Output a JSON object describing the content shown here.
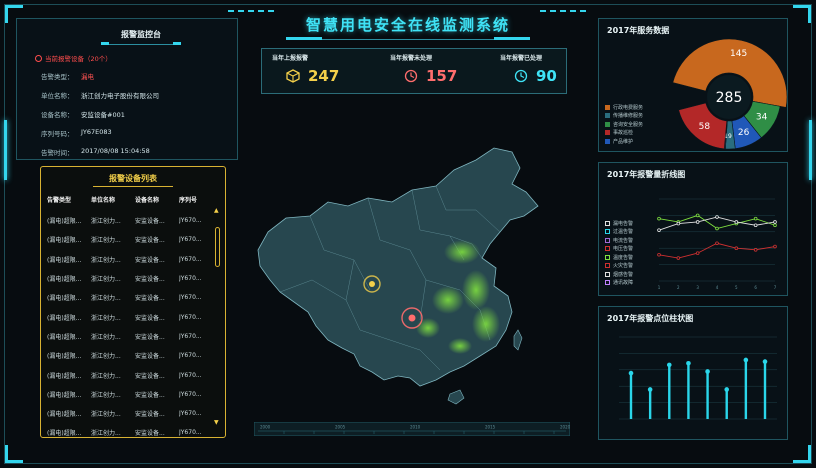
{
  "title": "智慧用电安全在线监测系统",
  "left_panel": {
    "title": "报警监控台",
    "alarm_devices": "当前报警设备（20个）",
    "info": [
      {
        "k": "告警类型：",
        "v": "漏电",
        "red": true
      },
      {
        "k": "单位名称：",
        "v": "浙江创力电子股份有限公司"
      },
      {
        "k": "设备名称：",
        "v": "安监设备#001"
      },
      {
        "k": "序列号码：",
        "v": "JY67E083"
      },
      {
        "k": "告警时间：",
        "v": "2017/08/08  15:04:58"
      }
    ]
  },
  "alarm_list": {
    "title": "报警设备列表",
    "columns": [
      "告警类型",
      "单位名称",
      "设备名称",
      "序列号"
    ],
    "rows": [
      [
        "(漏电)超限...",
        "浙江创力...",
        "安监设备...",
        "JY670..."
      ],
      [
        "(漏电)超限...",
        "浙江创力...",
        "安监设备...",
        "JY670..."
      ],
      [
        "(漏电)超限...",
        "浙江创力...",
        "安监设备...",
        "JY670..."
      ],
      [
        "(漏电)超限...",
        "浙江创力...",
        "安监设备...",
        "JY670..."
      ],
      [
        "(漏电)超限...",
        "浙江创力...",
        "安监设备...",
        "JY670..."
      ],
      [
        "(漏电)超限...",
        "浙江创力...",
        "安监设备...",
        "JY670..."
      ],
      [
        "(漏电)超限...",
        "浙江创力...",
        "安监设备...",
        "JY670..."
      ],
      [
        "(漏电)超限...",
        "浙江创力...",
        "安监设备...",
        "JY670..."
      ],
      [
        "(漏电)超限...",
        "浙江创力...",
        "安监设备...",
        "JY670..."
      ],
      [
        "(漏电)超限...",
        "浙江创力...",
        "安监设备...",
        "JY670..."
      ],
      [
        "(漏电)超限...",
        "浙江创力...",
        "安监设备...",
        "JY670..."
      ],
      [
        "(漏电)超限...",
        "浙江创力...",
        "安监设备...",
        "JY670..."
      ]
    ],
    "scroll_up": "▲",
    "scroll_down": "▼"
  },
  "stats": [
    {
      "label": "当年上报报警",
      "value": "247",
      "color": "#f4d04a",
      "icon": "cube-icon"
    },
    {
      "label": "当年报警未处理",
      "value": "157",
      "color": "#ff6d6d",
      "icon": "clock-icon"
    },
    {
      "label": "当年报警已处理",
      "value": "90",
      "color": "#3fe3f6",
      "icon": "clock-icon"
    }
  ],
  "timeline": {
    "ticks": [
      "2000",
      "2005",
      "2010",
      "2015",
      "2020"
    ]
  },
  "service_panel": {
    "title": "2017年服务数据",
    "total": "285",
    "segments": [
      {
        "label": "",
        "value": 145,
        "color": "#c8681e"
      },
      {
        "label": "",
        "value": 34,
        "color": "#2f8e46"
      },
      {
        "label": "",
        "value": 26,
        "color": "#2058b8"
      },
      {
        "label": "",
        "value": 9,
        "color": "#2a6d7e"
      },
      {
        "label": "",
        "value": 1,
        "color": "#2c4366"
      },
      {
        "label": "",
        "value": 58,
        "color": "#b32828"
      }
    ],
    "legend": [
      {
        "label": "行政电费服务",
        "color": "#c8681e"
      },
      {
        "label": "传播维修服务",
        "color": "#2a6d7e"
      },
      {
        "label": "咨询安全服务",
        "color": "#2f8e46"
      },
      {
        "label": "事故巡检",
        "color": "#b32828"
      },
      {
        "label": "产品维护",
        "color": "#2058b8"
      }
    ]
  },
  "line_panel": {
    "title": "2017年报警量折线图",
    "legend": [
      {
        "label": "漏电告警",
        "color": "#e0e0e0"
      },
      {
        "label": "过温告警",
        "color": "#2ad6ea"
      },
      {
        "label": "电流告警",
        "color": "#a36ad6"
      },
      {
        "label": "电压告警",
        "color": "#d03030"
      },
      {
        "label": "温度告警",
        "color": "#7fdf3f"
      },
      {
        "label": "火灾告警",
        "color": "#d03030"
      },
      {
        "label": "烟感告警",
        "color": "#e0e0e0"
      },
      {
        "label": "通讯故障",
        "color": "#c080ff"
      }
    ]
  },
  "bar_panel": {
    "title": "2017年报警点位柱状图"
  },
  "chart_data": [
    {
      "type": "pie",
      "title": "2017年服务数据",
      "total": 285,
      "values": [
        145,
        34,
        26,
        9,
        1,
        58
      ]
    },
    {
      "type": "line",
      "title": "2017年报警量折线图",
      "x": [
        1,
        2,
        3,
        4,
        5,
        6,
        7
      ],
      "ylim": [
        0,
        5
      ],
      "series": [
        {
          "name": "",
          "color": "#7fdf3f",
          "values": [
            3.8,
            3.6,
            4.0,
            3.2,
            3.5,
            3.8,
            3.4
          ]
        },
        {
          "name": "",
          "color": "#e0e0e0",
          "values": [
            3.1,
            3.5,
            3.6,
            3.9,
            3.6,
            3.4,
            3.6
          ]
        },
        {
          "name": "",
          "color": "#d03030",
          "values": [
            1.6,
            1.4,
            1.7,
            2.3,
            2.0,
            1.9,
            2.1
          ]
        }
      ]
    },
    {
      "type": "bar",
      "title": "2017年报警点位柱状图",
      "ylim": [
        0,
        5
      ],
      "values": [
        2.8,
        1.8,
        3.3,
        3.4,
        2.9,
        1.8,
        3.6,
        3.5
      ]
    }
  ]
}
